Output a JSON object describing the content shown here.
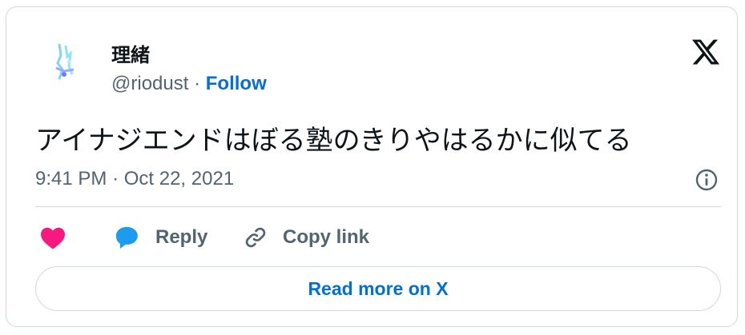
{
  "author": {
    "name": "理緒",
    "handle": "@riodust",
    "separator": "·",
    "follow_label": "Follow"
  },
  "tweet": {
    "text": "アイナジエンドはぼる塾のきりやはるかに似てる",
    "time": "9:41 PM",
    "date_separator": "·",
    "date": "Oct 22, 2021"
  },
  "actions": {
    "like_icon": "heart-icon",
    "reply_label": "Reply",
    "copy_label": "Copy link"
  },
  "read_more_label": "Read more on X",
  "colors": {
    "like": "#f91880",
    "reply_icon": "#1d9bf0",
    "link": "#006fd6",
    "muted": "#536471",
    "border": "#cfd9de"
  }
}
